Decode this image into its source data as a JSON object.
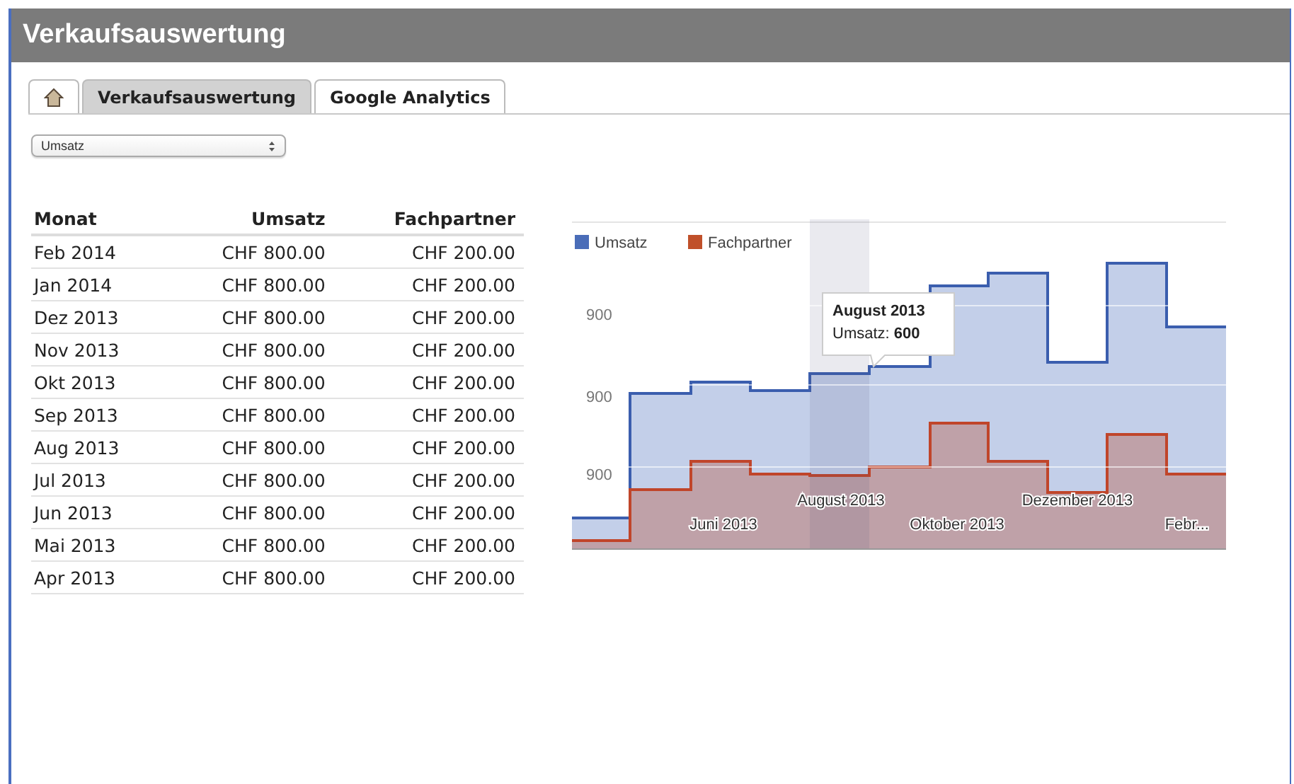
{
  "window": {
    "title": "Verkaufsauswertung"
  },
  "tabs": [
    {
      "kind": "home",
      "selected": false
    },
    {
      "kind": "text",
      "label": "Verkaufsauswertung",
      "selected": true
    },
    {
      "kind": "text",
      "label": "Google Analytics",
      "selected": false
    }
  ],
  "select": {
    "value": "Umsatz"
  },
  "table": {
    "columns": [
      "Monat",
      "Umsatz",
      "Fachpartner"
    ],
    "rows": [
      [
        "Feb 2014",
        "CHF 800.00",
        "CHF 200.00"
      ],
      [
        "Jan 2014",
        "CHF 800.00",
        "CHF 200.00"
      ],
      [
        "Dez 2013",
        "CHF 800.00",
        "CHF 200.00"
      ],
      [
        "Nov 2013",
        "CHF 800.00",
        "CHF 200.00"
      ],
      [
        "Okt 2013",
        "CHF 800.00",
        "CHF 200.00"
      ],
      [
        "Sep 2013",
        "CHF 800.00",
        "CHF 200.00"
      ],
      [
        "Aug 2013",
        "CHF 800.00",
        "CHF 200.00"
      ],
      [
        "Jul 2013",
        "CHF 800.00",
        "CHF 200.00"
      ],
      [
        "Jun 2013",
        "CHF 800.00",
        "CHF 200.00"
      ],
      [
        "Mai 2013",
        "CHF 800.00",
        "CHF 200.00"
      ],
      [
        "Apr 2013",
        "CHF 800.00",
        "CHF 200.00"
      ]
    ]
  },
  "chart": {
    "legend": [
      {
        "label": "Umsatz",
        "color": "#4a6db8"
      },
      {
        "label": "Fachpartner",
        "color": "#c0502a"
      }
    ],
    "y_labels": [
      "900",
      "900",
      "900"
    ],
    "x_labels": [
      "Juni 2013",
      "August 2013",
      "Oktober 2013",
      "Dezember 2013",
      "Febr..."
    ],
    "tooltip": {
      "title": "August 2013",
      "label": "Umsatz:",
      "value": "600"
    }
  }
}
